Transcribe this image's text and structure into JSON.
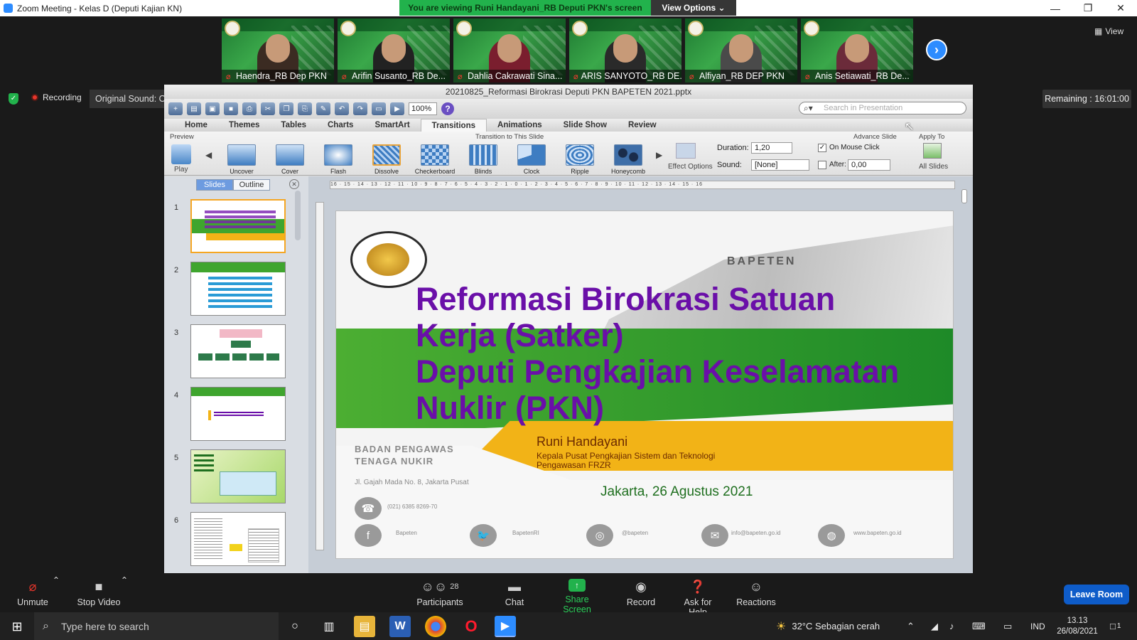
{
  "window": {
    "title": "Zoom Meeting - Kelas D (Deputi Kajian KN)",
    "share_banner": "You are viewing Runi Handayani_RB Deputi PKN's screen",
    "view_options": "View Options ⌄",
    "minimize": "—",
    "maximize": "❐",
    "close": "✕"
  },
  "participants": [
    {
      "name": "Haendra_RB Dep PKN"
    },
    {
      "name": "Arifin Susanto_RB De..."
    },
    {
      "name": "Dahlia Cakrawati Sina..."
    },
    {
      "name": "ARIS SANYOTO_RB DE..."
    },
    {
      "name": "Alfiyan_RB DEP PKN"
    },
    {
      "name": "Anis Setiawati_RB De..."
    }
  ],
  "view_button": "View",
  "status": {
    "recording": "Recording",
    "original_sound": "Original Sound: On",
    "remaining": "Remaining : 16:01:00"
  },
  "ppt": {
    "file_title": "20210825_Reformasi Birokrasi Deputi PKN BAPETEN 2021.pptx",
    "zoom": "100%",
    "search_placeholder": "Search in Presentation",
    "tabs": [
      "Home",
      "Themes",
      "Tables",
      "Charts",
      "SmartArt",
      "Transitions",
      "Animations",
      "Slide Show",
      "Review"
    ],
    "groups": {
      "preview": "Preview",
      "transition": "Transition to This Slide",
      "advance": "Advance Slide",
      "apply": "Apply To"
    },
    "play": "Play",
    "transitions": [
      "Uncover",
      "Cover",
      "Flash",
      "Dissolve",
      "Checkerboard",
      "Blinds",
      "Clock",
      "Ripple",
      "Honeycomb"
    ],
    "effect_options": "Effect Options",
    "duration_label": "Duration:",
    "duration_value": "1,20",
    "sound_label": "Sound:",
    "sound_value": "[None]",
    "on_mouse_click": "On Mouse Click",
    "after_label": "After:",
    "after_value": "0,00",
    "all_slides": "All Slides",
    "panel_tabs": {
      "slides": "Slides",
      "outline": "Outline"
    },
    "slide_numbers": [
      "1",
      "2",
      "3",
      "4",
      "5",
      "6"
    ],
    "ruler_text": "16 · 15 · 14 · 13 · 12 · 11 · 10 · 9 · 8 · 7 · 6 · 5 · 4 · 3 · 2 · 1 · 0 · 1 · 2 · 3 · 4 · 5 · 6 · 7 · 8 · 9 · 10 · 11 · 12 · 13 · 14 · 15 · 16"
  },
  "slide": {
    "title_lines": [
      "Reformasi Birokrasi  Satuan",
      "Kerja (Satker)",
      "Deputi Pengkajian Keselamatan",
      "Nuklir (PKN)"
    ],
    "presenter": "Runi Handayani",
    "presenter_role": "Kepala Pusat Pengkajian Sistem dan Teknologi Pengawasan FRZR",
    "place_date": "Jakarta, 26 Agustus 2021",
    "org_name_1": "BADAN PENGAWAS",
    "org_name_2": "TENAGA NUKIR",
    "address": "Jl. Gajah Mada  No. 8, Jakarta Pusat",
    "phone": "(021) 6385 8269-70",
    "building_sign": "BAPETEN",
    "social": [
      "Bapeten",
      "BapetenRI",
      "@bapeten",
      "info@bapeten.go.id",
      "www.bapeten.go.id"
    ]
  },
  "bottom_bar": {
    "unmute": "Unmute",
    "stop_video": "Stop Video",
    "participants_label": "Participants",
    "participants_count": "28",
    "chat": "Chat",
    "share_screen": "Share Screen",
    "record": "Record",
    "ask_help": "Ask for Help",
    "reactions": "Reactions",
    "leave": "Leave Room"
  },
  "taskbar": {
    "search": "Type here to search",
    "weather": "32°C  Sebagian cerah",
    "lang": "IND",
    "time": "13.13",
    "date": "26/08/2021",
    "notif_count": "1"
  },
  "colors": {
    "zoom_blue": "#2d8cff",
    "share_green": "#22b24c",
    "title_purple": "#6a0fa8",
    "slide_green": "#3fa52e",
    "slide_yellow": "#f2b317"
  }
}
